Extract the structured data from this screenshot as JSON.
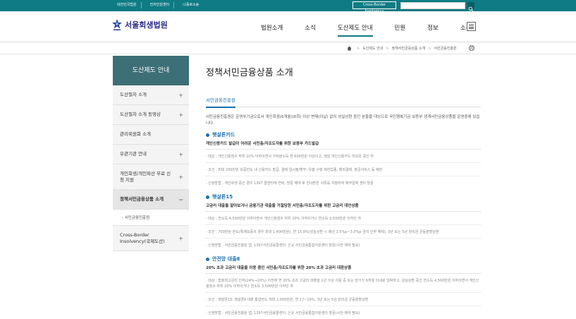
{
  "topbar": {
    "links": [
      "대한민국법원",
      "전자민원센터",
      "나홀로소송"
    ],
    "cross_border": "Cross-Border Insolvency"
  },
  "header": {
    "logo_text": "서울회생법원",
    "nav": [
      "법원소개",
      "소식",
      "도산제도 안내",
      "민원",
      "정보",
      "소통"
    ],
    "active_nav": "도산제도 안내"
  },
  "breadcrumb": [
    "도산제도 안내",
    "정책서민금융상품 소개",
    "서민금융진흥원"
  ],
  "sidebar": {
    "title": "도산제도 안내",
    "items": [
      {
        "label": "도산절차 소개",
        "marker": "+"
      },
      {
        "label": "도산절차 소개 동영상",
        "marker": "+"
      },
      {
        "label": "관리위원회 소개",
        "marker": ""
      },
      {
        "label": "유관기관 안내",
        "marker": "+"
      },
      {
        "label": "개인회생/개인파산 무료 신청 지원",
        "marker": "+"
      },
      {
        "label": "정책서민금융상품 소개",
        "marker": "−"
      },
      {
        "label": "Cross-Border Insolvency(국제도산)",
        "marker": "+"
      }
    ],
    "sub_item": "- 서민금융진흥원"
  },
  "content": {
    "page_title": "정책서민금융상품 소개",
    "section_title": "서민금융진흥원",
    "intro": "서민금융진흥원은 운영부기금으로서 개인회생(6개월)(6회) 이상 변제(이날) 없이 성실상환 중인 분들을 대상으로 국민행복기금 보증부 생계서민금융상품을 운영중에 있습니다.",
    "products": [
      {
        "title": "햇살론카드",
        "desc": "개인신용카드 발급이 어려운 서민층/자조도자를 위한 보증부 카드발급",
        "lines": [
          "· 대상 : 개인신용점수 하위 10% 이하이면서 가처분소득 연 600만원 이상이고, 햇살 개인신용카드 미보유 중인 자",
          "· 조건 : 최대 200만원 보증한도 내 신용카드 발급, 결제 일시불/할부, 유흥·사행 제한업종, 해외결제, 현금서비스 등 제한",
          "· 신청방법 : 개인회생 중인 경우 1397 콜센터에 연락, 방문 예약 후 안내받은 서류를 지참하여 예약일에 센터 방문"
        ]
      },
      {
        "title": "햇살론15",
        "desc": "고금리 대출을 알아보거나 금융기관 대출을 거절당한 서민층/자조도자를 위한 고금리 대안상품",
        "lines": [
          "· 대상 : 연소득 4,500만원 이하이면서 개인신용점수 하위 20% 이하이거나 연소득 3,500만원 이하인 자",
          "· 조건 : 700만원 한도(특례보증의 경우 최대 1,400만원), 연 15.9%(성실상환 시 매년 1.5%p~3.0%p 금리 인하 혜택), 3년 또는 5년 원리금 균등분할상환",
          "· 신청방법 : 서민금융진흥원 앱, 1397서민금융콜센터, 신규 서민금융통합지원센터 방문(사전 예약 필요)"
        ]
      },
      {
        "title": "안전망 대출Ⅱ",
        "desc": "20% 초과 고금리 대출을 이용 중인 서민층/자조도자를 위한 20% 초과 고금리 대환상품",
        "lines": [
          "· 대상 : 법정최고금리 인하(24%→20%) 이전에 연 20% 초과 고금리 대출을 1년 이상 이용 중 또는 만기가 6개월 이내로 임박하고, 성실상환 중인 연소득 4,500만원 이하이면서 개인신용점수 하위 20% 이하이거나 연소득 3,500만원 이하인 자",
          "· 조건 : 햇살론15, 햇살론Ⅱ 대출 통합한도 최대 2,000만원, 연 17~19%, 3년 또는 5년 원리금 균등분할상환",
          "· 신청방법 : 서민금융진흥원 앱, 1397서민금융콜센터, 신규 서민금융통합지원센터 방문(사전 예약 필요)"
        ]
      }
    ]
  },
  "colors": {
    "teal": "#0f7b84",
    "sidebar_title": "#3d6f76",
    "accent_blue": "#1b6fae"
  }
}
